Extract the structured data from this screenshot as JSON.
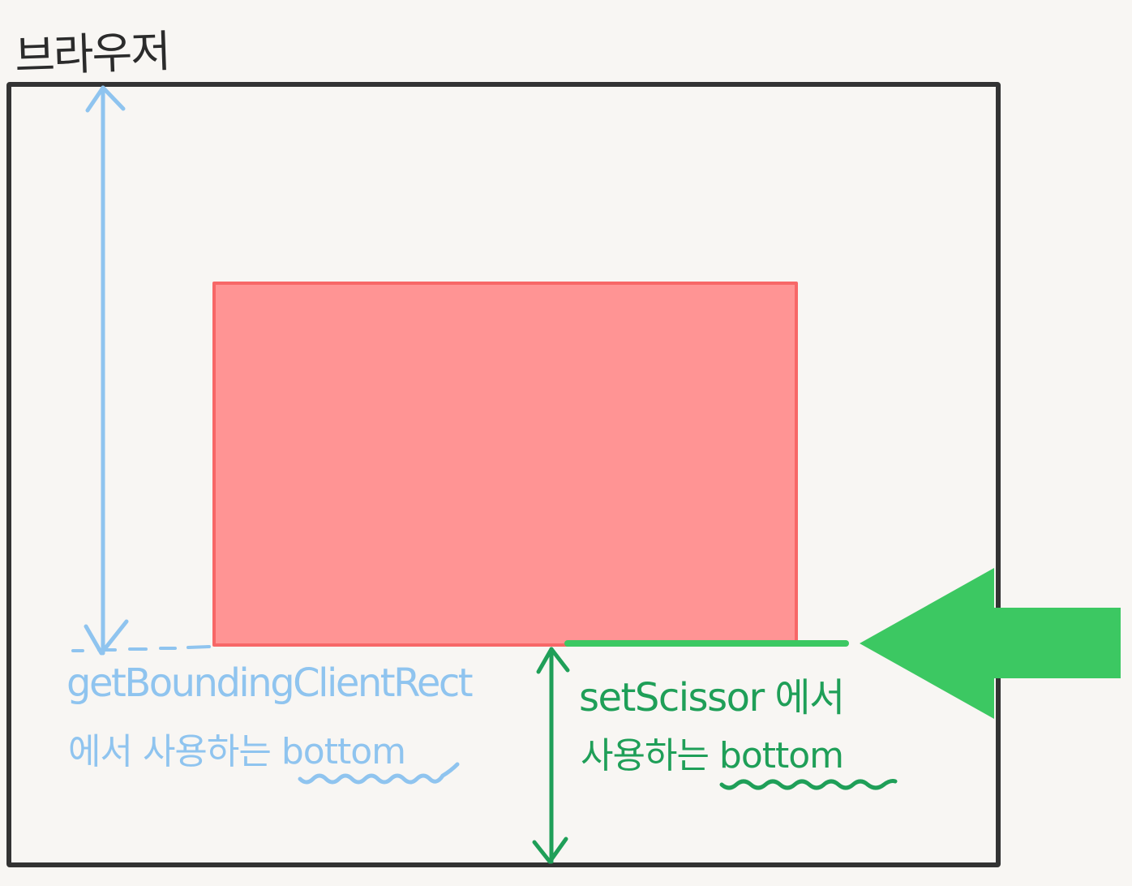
{
  "diagram": {
    "title": "브라우저",
    "blue_label": {
      "line1": "getBoundingClientRect",
      "line2": "에서 사용하는 bottom"
    },
    "green_label": {
      "line1": "setScissor 에서",
      "line2": "사용하는 bottom"
    },
    "colors": {
      "frame": "#333333",
      "rect_fill": "#ff9494",
      "rect_border": "#f76767",
      "blue": "#8fc4ef",
      "green": "#1f9f58",
      "pointer_green": "#3cc862",
      "background": "#f8f6f3"
    }
  }
}
